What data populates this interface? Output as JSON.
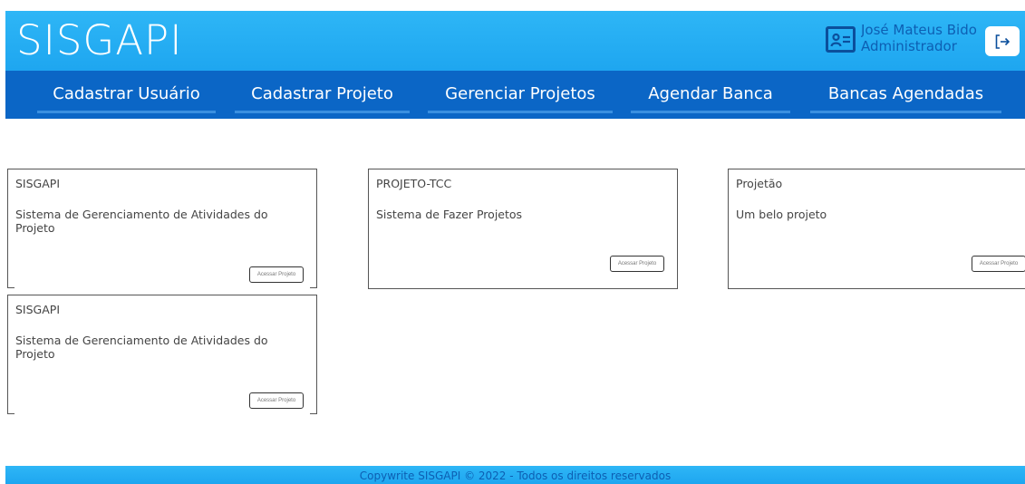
{
  "header": {
    "brand": "SISGAPI",
    "user_name": "José Mateus Bido",
    "user_role": "Administrador",
    "user_icon": "id-card-icon",
    "logout_icon": "logout-icon"
  },
  "nav": {
    "items": [
      {
        "label": "Cadastrar Usuário"
      },
      {
        "label": "Cadastrar Projeto"
      },
      {
        "label": "Gerenciar Projetos"
      },
      {
        "label": "Agendar Banca"
      },
      {
        "label": "Bancas Agendadas"
      }
    ]
  },
  "projects": [
    {
      "title": "SISGAPI",
      "description": "Sistema de Gerenciamento de Atividades do Projeto",
      "button": "Acessar Projeto"
    },
    {
      "title": "PROJETO-TCC",
      "description": "Sistema de Fazer Projetos",
      "button": "Acessar Projeto"
    },
    {
      "title": "Projetão",
      "description": "Um belo projeto",
      "button": "Acessar Projeto"
    },
    {
      "title": "SISGAPI",
      "description": "Sistema de Gerenciamento de Atividades do Projeto",
      "button": "Acessar Projeto"
    }
  ],
  "footer": {
    "text": "Copywrite SISGAPI © 2022 - Todos os direitos reservados"
  },
  "colors": {
    "header_bg": "#2eb6f6",
    "nav_bg": "#0b66c6",
    "accent_dark": "#0d5fb3"
  }
}
